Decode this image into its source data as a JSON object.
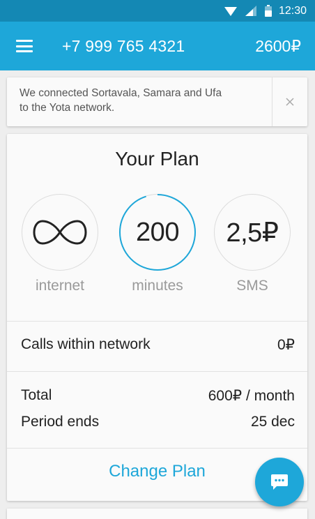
{
  "status_bar": {
    "time": "12:30",
    "icons": [
      "wifi-icon",
      "signal-icon",
      "battery-icon"
    ]
  },
  "app_bar": {
    "menu_icon": "hamburger-menu-icon",
    "phone_number": "+7 999 765 4321",
    "balance": "2600₽"
  },
  "notice": {
    "line1": "We connected Sortavala, Samara and Ufa",
    "line2": "to the Yota network.",
    "close_icon": "close-icon"
  },
  "plan": {
    "title": "Your Plan",
    "internet": {
      "value_icon": "infinity-icon",
      "label": "internet"
    },
    "minutes": {
      "value": "200",
      "label": "minutes",
      "progress": 0.95
    },
    "sms": {
      "value": "2,5₽",
      "label": "SMS"
    },
    "calls_within_network": {
      "label": "Calls within network",
      "value": "0₽"
    },
    "total": {
      "label": "Total",
      "value": "600₽ / month"
    },
    "period_ends": {
      "label": "Period ends",
      "value": "25 dec"
    },
    "change_plan": "Change Plan"
  },
  "fab": {
    "icon": "chat-icon"
  },
  "colors": {
    "accent": "#1ea7d9",
    "status_bar": "#1488b4",
    "background": "#eeeeee",
    "card": "#fafafa"
  }
}
